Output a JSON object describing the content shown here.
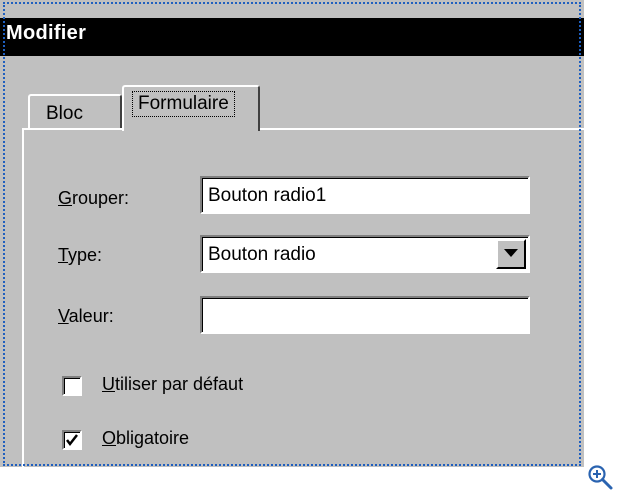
{
  "dialog": {
    "title": "Modifier"
  },
  "tabs": [
    {
      "label": "Bloc",
      "selected": false
    },
    {
      "label": "Formulaire",
      "selected": true
    }
  ],
  "form": {
    "group": {
      "mnemonic": "G",
      "rest": "rouper:",
      "value": "Bouton radio1"
    },
    "type": {
      "mnemonic": "T",
      "rest": "ype:",
      "value": "Bouton radio"
    },
    "valeur": {
      "mnemonic": "V",
      "rest": "aleur:",
      "value": ""
    },
    "default": {
      "mnemonic": "U",
      "rest": "tiliser par défaut",
      "checked": false
    },
    "required": {
      "mnemonic": "O",
      "rest": "bligatoire",
      "checked": true
    }
  },
  "icons": {
    "dropdown": "chevron-down-icon",
    "zoom": "zoom-in-icon"
  },
  "colors": {
    "title_bar": "#000000",
    "dialog_bg": "#c0c0c0",
    "frame": "#1f5fbf"
  }
}
